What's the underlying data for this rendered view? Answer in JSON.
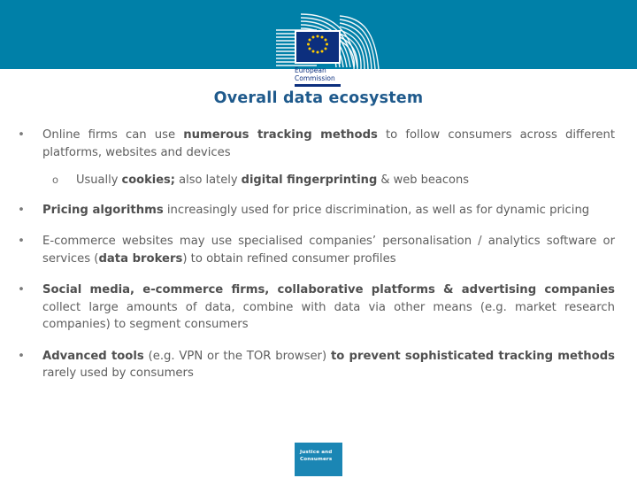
{
  "header": {
    "banner_color": "#0080a8",
    "logo": {
      "name": "european-commission-logo",
      "flag_blue": "#0c2f7e",
      "star_yellow": "#ffcc00",
      "line1": "European",
      "line2": "Commission"
    }
  },
  "title": {
    "text": "Overall data ecosystem",
    "color": "#1f5a8c"
  },
  "bullets": [
    {
      "marker": "•",
      "level": 0,
      "segments": [
        {
          "text": "Online firms can use ",
          "bold": false
        },
        {
          "text": "numerous tracking methods",
          "bold": true
        },
        {
          "text": " to follow consumers across different platforms, websites and devices",
          "bold": false
        }
      ]
    },
    {
      "marker": "o",
      "level": 1,
      "segments": [
        {
          "text": "Usually ",
          "bold": false
        },
        {
          "text": "cookies;",
          "bold": true
        },
        {
          "text": " also lately ",
          "bold": false
        },
        {
          "text": "digital fingerprinting",
          "bold": true
        },
        {
          "text": " & web beacons",
          "bold": false
        }
      ]
    },
    {
      "marker": "•",
      "level": 0,
      "segments": [
        {
          "text": "Pricing algorithms",
          "bold": true
        },
        {
          "text": " increasingly used for price discrimination, as well as for dynamic pricing",
          "bold": false
        }
      ]
    },
    {
      "marker": "•",
      "level": 0,
      "segments": [
        {
          "text": "E-commerce websites may use specialised companies’ personalisation / analytics software or services (",
          "bold": false
        },
        {
          "text": "data brokers",
          "bold": true
        },
        {
          "text": ") to obtain refined consumer profiles",
          "bold": false
        }
      ]
    },
    {
      "marker": "•",
      "level": 0,
      "segments": [
        {
          "text": "Social media, e-commerce firms, collaborative platforms & advertising companies",
          "bold": true
        },
        {
          "text": " collect large amounts of data, combine with data via other means (e.g. market research companies) to segment consumers",
          "bold": false
        }
      ]
    },
    {
      "marker": "•",
      "level": 0,
      "segments": [
        {
          "text": "Advanced tools",
          "bold": true
        },
        {
          "text": " (e.g. VPN or the TOR browser) ",
          "bold": false
        },
        {
          "text": "to prevent sophisticated tracking methods",
          "bold": true
        },
        {
          "text": " rarely used by consumers",
          "bold": false
        }
      ]
    }
  ],
  "footer_badge": {
    "line1": "Justice and",
    "line2": "Consumers",
    "background": "#1b86b4",
    "text_color": "#ffffff"
  }
}
